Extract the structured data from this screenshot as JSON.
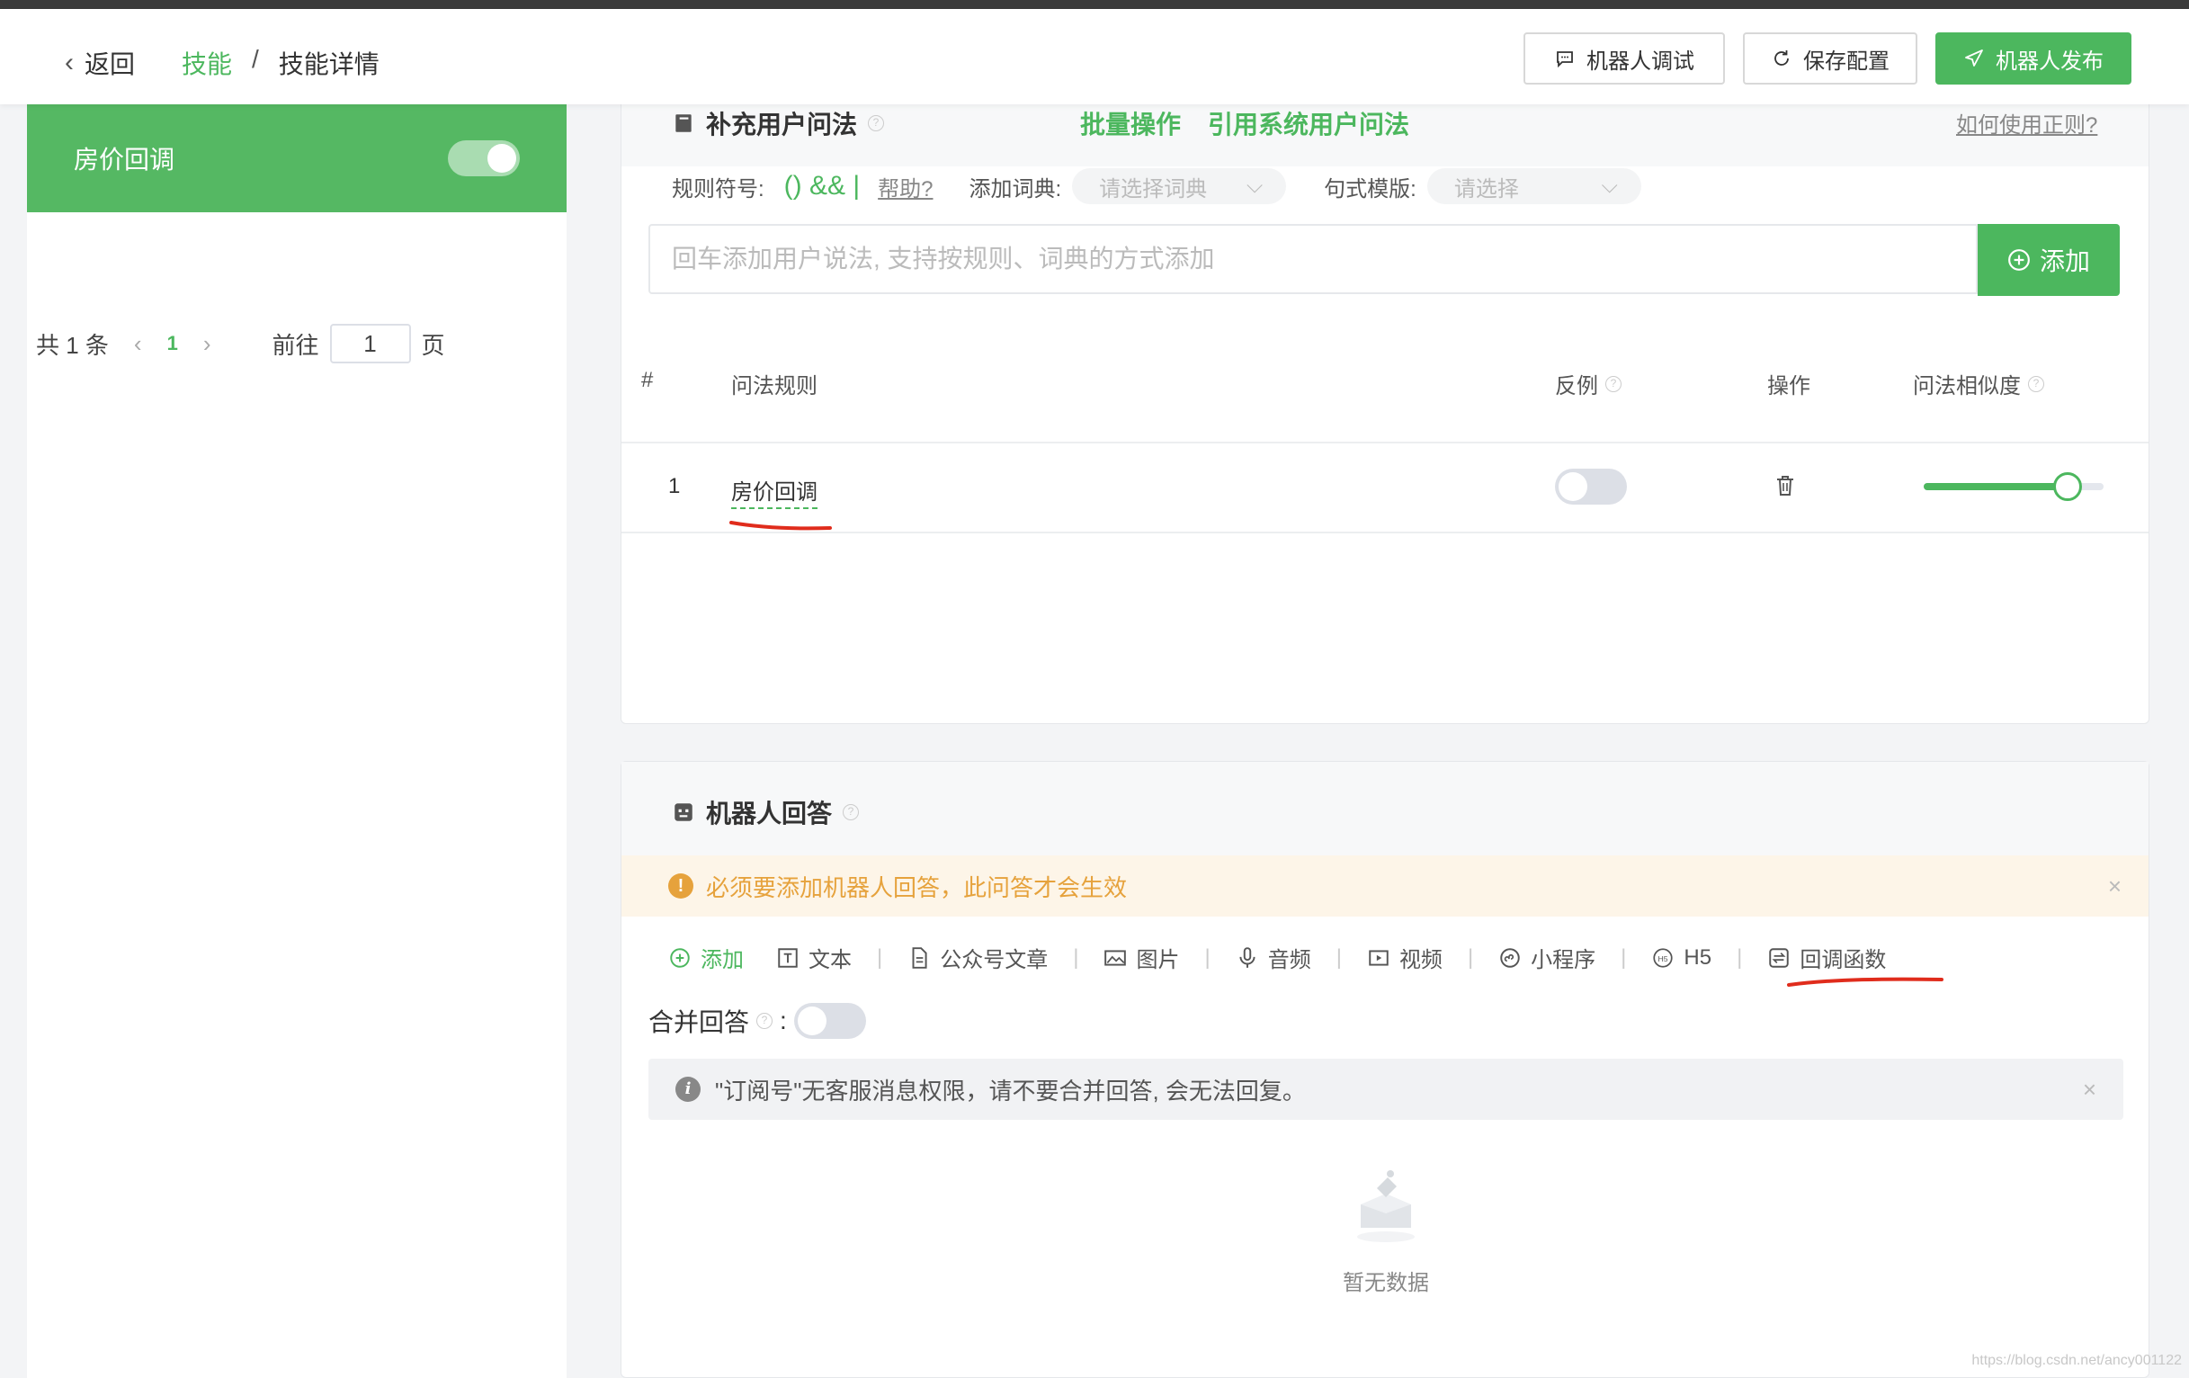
{
  "header": {
    "back_label": "返回",
    "breadcrumb": {
      "parent": "技能",
      "separator": "/",
      "current": "技能详情"
    },
    "buttons": {
      "debug": "机器人调试",
      "save": "保存配置",
      "publish": "机器人发布"
    }
  },
  "sidebar": {
    "skills": [
      {
        "name": "房价回调",
        "enabled": true
      }
    ],
    "pagination": {
      "total_text": "共 1 条",
      "current_page": "1",
      "goto_label": "前往",
      "goto_value": "1",
      "page_suffix": "页"
    }
  },
  "questions": {
    "title": "补充用户问法",
    "batch_label": "批量操作",
    "reference_label": "引用系统用户问法",
    "regex_help": "如何使用正则?",
    "rule_symbols_label": "规则符号:",
    "symbols": "() && |",
    "help_link": "帮助?",
    "dict_label": "添加词典:",
    "dict_placeholder": "请选择词典",
    "template_label": "句式模版:",
    "template_placeholder": "请选择",
    "input_placeholder": "回车添加用户说法, 支持按规则、词典的方式添加",
    "add_label": "添加",
    "table": {
      "columns": {
        "index": "#",
        "rule": "问法规则",
        "counter": "反例",
        "actions": "操作",
        "similarity": "问法相似度"
      },
      "rows": [
        {
          "index": "1",
          "rule": "房价回调",
          "counter_example": false,
          "similarity": 0.8
        }
      ]
    }
  },
  "answers": {
    "title": "机器人回答",
    "warning": "必须要添加机器人回答，此问答才会生效",
    "types": {
      "add": "添加",
      "text": "文本",
      "article": "公众号文章",
      "image": "图片",
      "audio": "音频",
      "video": "视频",
      "miniprogram": "小程序",
      "h5": "H5",
      "callback": "回调函数"
    },
    "merge_label": "合并回答",
    "merge_colon": ":",
    "merge_enabled": false,
    "info": "\"订阅号\"无客服消息权限，请不要合并回答, 会无法回复。",
    "empty_text": "暂无数据"
  },
  "watermark": "https://blog.csdn.net/ancy001122"
}
